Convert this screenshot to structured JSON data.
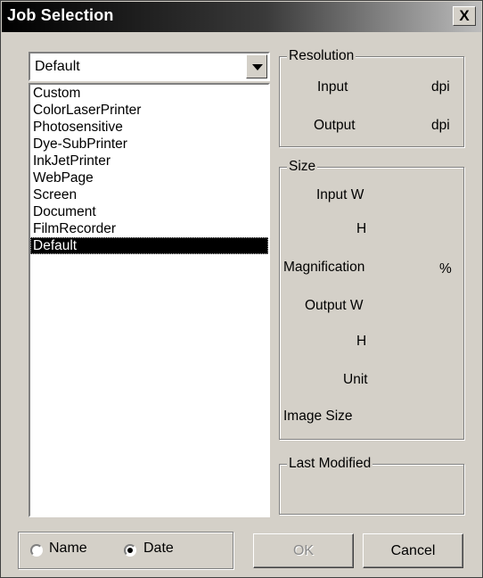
{
  "window": {
    "title": "Job Selection",
    "close_label": "X"
  },
  "job_combo": {
    "value": "Default"
  },
  "job_list": {
    "items": [
      "Custom",
      "ColorLaserPrinter",
      "Photosensitive",
      "Dye-SubPrinter",
      "InkJetPrinter",
      "WebPage",
      "Screen",
      "Document",
      "FilmRecorder",
      "Default"
    ],
    "selected": "Default"
  },
  "resolution": {
    "title": "Resolution",
    "input_label": "Input",
    "output_label": "Output",
    "unit": "dpi"
  },
  "size": {
    "title": "Size",
    "input_w_label": "Input W",
    "input_h_label": "H",
    "magnification_label": "Magnification",
    "magnification_unit": "%",
    "output_w_label": "Output W",
    "output_h_label": "H",
    "unit_label": "Unit",
    "image_size_label": "Image Size"
  },
  "last_modified": {
    "title": "Last Modified"
  },
  "sort": {
    "name_label": "Name",
    "date_label": "Date",
    "selected": "date"
  },
  "buttons": {
    "ok": "OK",
    "ok_enabled": false,
    "cancel": "Cancel"
  }
}
